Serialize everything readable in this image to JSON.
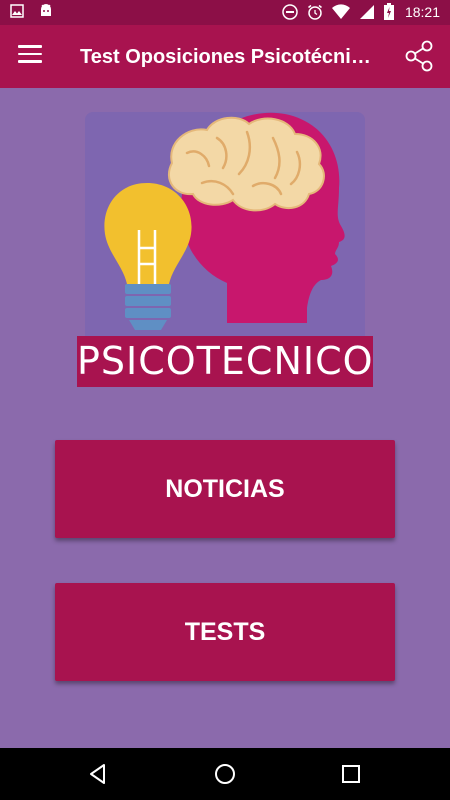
{
  "status_bar": {
    "time": "18:21",
    "left_icons": [
      "image-notification-icon",
      "android-notification-icon"
    ],
    "right_icons": [
      "do-not-disturb-icon",
      "alarm-icon",
      "wifi-icon",
      "signal-icon",
      "battery-icon"
    ]
  },
  "toolbar": {
    "title": "Test Oposiciones Psicotécnicos",
    "menu_icon": "hamburger-menu-icon",
    "share_icon": "share-icon"
  },
  "logo": {
    "banner_text": "PSICOTECNICO"
  },
  "main": {
    "noticias_label": "NOTICIAS",
    "tests_label": "TESTS"
  },
  "nav_bar": {
    "icons": [
      "back-icon",
      "home-icon",
      "recents-icon"
    ]
  },
  "colors": {
    "background": "#8b6aac",
    "primary": "#a8134f",
    "primary_dark": "#8c0f47"
  }
}
